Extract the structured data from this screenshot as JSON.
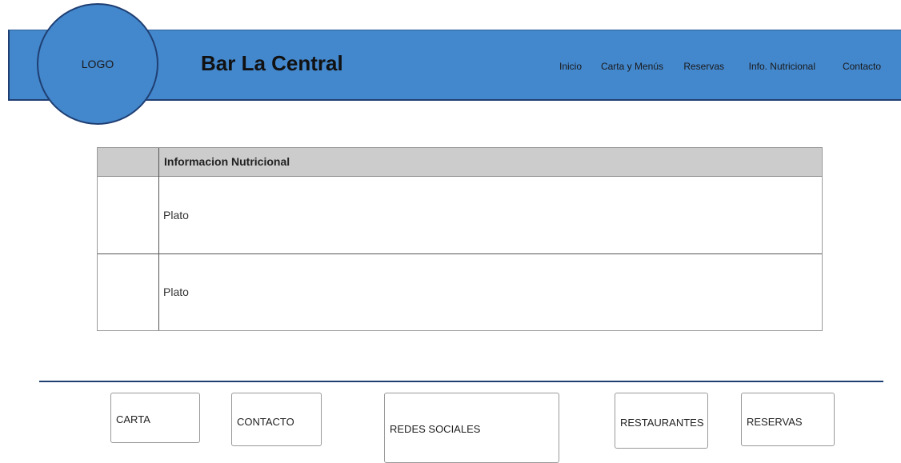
{
  "header": {
    "logo": "LOGO",
    "title": "Bar La Central",
    "nav": [
      "Inicio",
      "Carta y Menús",
      "Reservas",
      "Info. Nutricional",
      "Contacto"
    ]
  },
  "table": {
    "header": "Informacion Nutricional",
    "rows": [
      "Plato",
      "Plato"
    ]
  },
  "footer": {
    "buttons": [
      "CARTA",
      "CONTACTO",
      "REDES SOCIALES",
      "RESTAURANTES",
      "RESERVAS"
    ]
  },
  "colors": {
    "header_bg": "#4387cc",
    "header_border": "#1f3f73",
    "table_header_bg": "#cccccc"
  }
}
